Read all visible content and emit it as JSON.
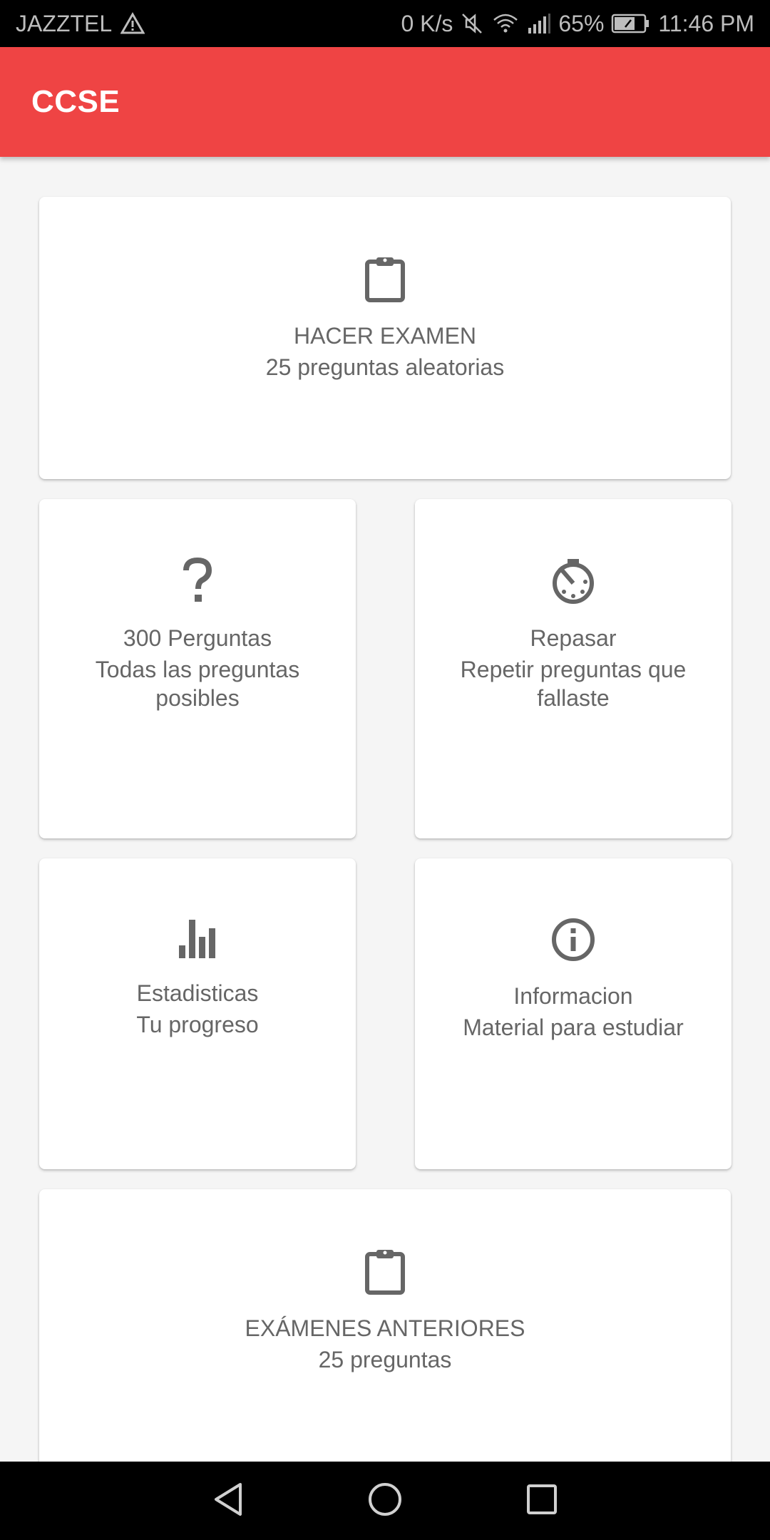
{
  "status_bar": {
    "carrier": "JAZZTEL",
    "speed": "0 K/s",
    "battery": "65%",
    "time": "11:46 PM"
  },
  "app_bar": {
    "title": "CCSE"
  },
  "cards": {
    "exam": {
      "title": "HACER EXAMEN",
      "subtitle": "25 preguntas aleatorias",
      "icon": "clipboard-icon"
    },
    "all_questions": {
      "title": "300 Perguntas",
      "subtitle": "Todas las preguntas posibles",
      "icon": "question-mark-icon"
    },
    "review": {
      "title": "Repasar",
      "subtitle": "Repetir preguntas que fallaste",
      "icon": "timer-off-icon"
    },
    "stats": {
      "title": "Estadisticas",
      "subtitle": "Tu progreso",
      "icon": "bar-chart-icon"
    },
    "info": {
      "title": "Informacion",
      "subtitle": "Material para estudiar",
      "icon": "info-icon"
    },
    "previous_exams": {
      "title": "EXÁMENES ANTERIORES",
      "subtitle": "25 preguntas",
      "icon": "clipboard-icon"
    }
  },
  "colors": {
    "app_bar": "#ef4444",
    "icon": "#666666",
    "text": "#666666",
    "background": "#f5f5f5"
  }
}
